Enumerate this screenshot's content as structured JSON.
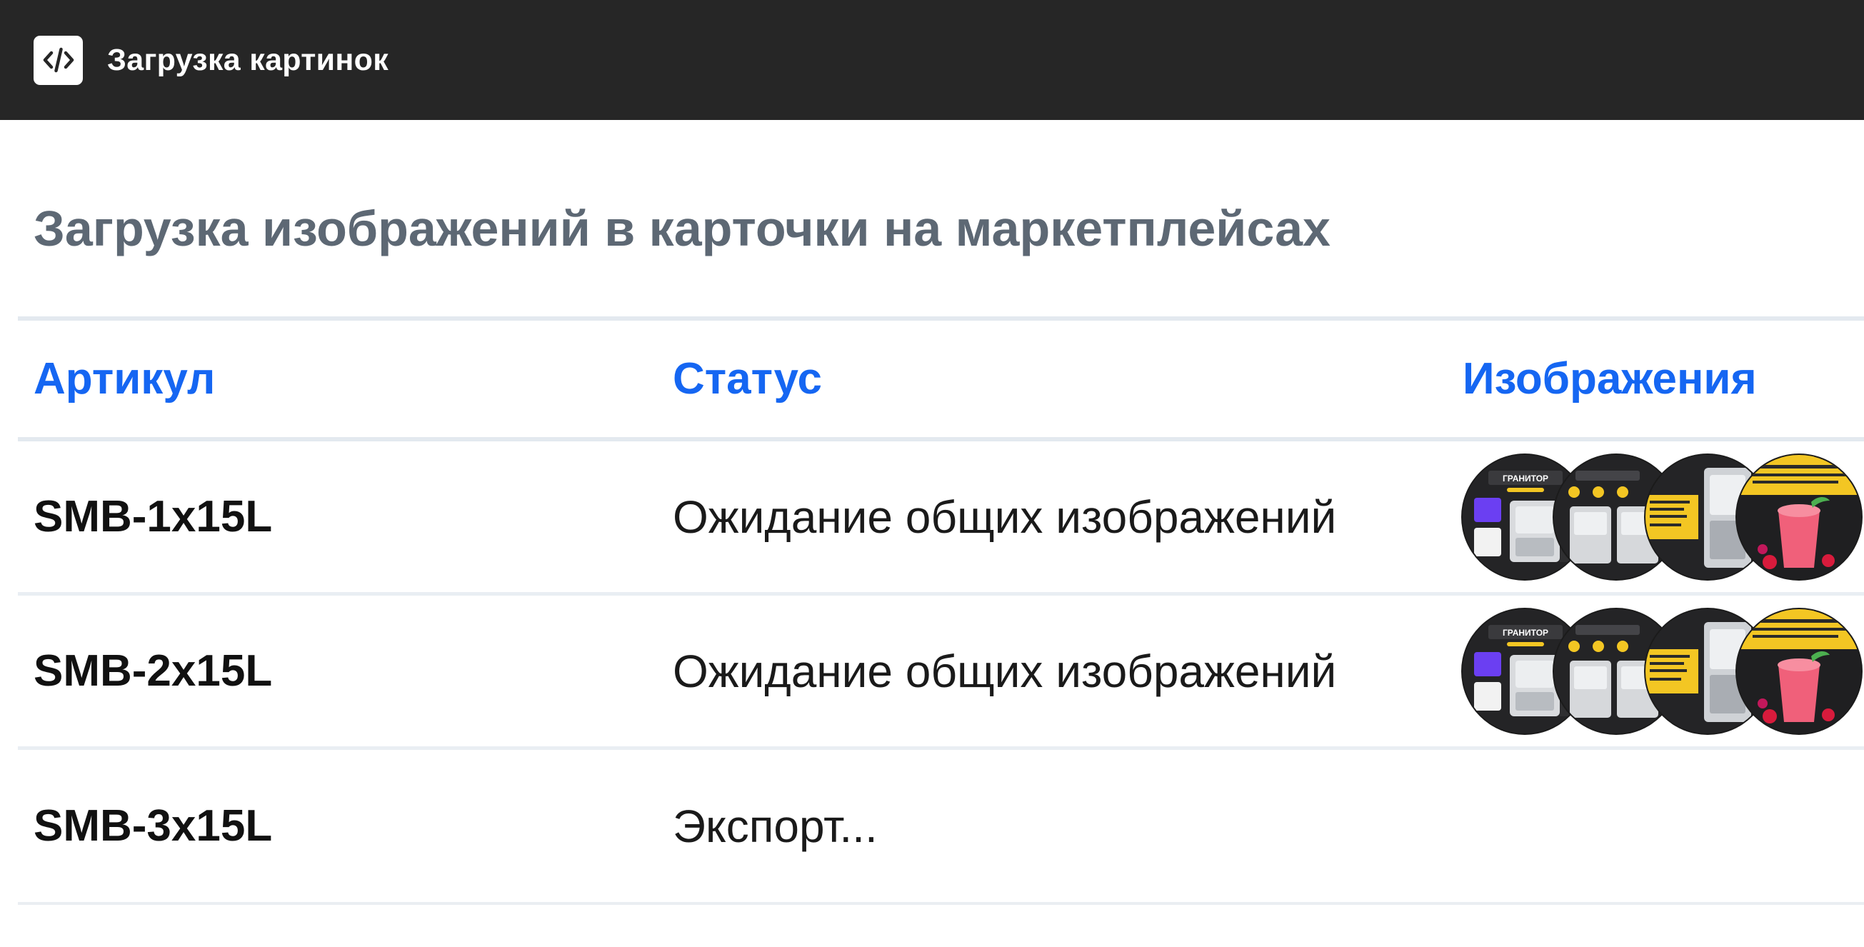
{
  "app": {
    "title": "Загрузка картинок",
    "icon": "code-icon"
  },
  "page": {
    "title": "Загрузка изображений в карточки на маркетплейсах"
  },
  "table": {
    "columns": [
      "Артикул",
      "Статус",
      "Изображения"
    ],
    "rows": [
      {
        "sku": "SMB-1x15L",
        "status": "Ожидание общих изображений",
        "images": [
          "product-card-image-1",
          "product-card-image-2",
          "product-card-image-3",
          "product-card-image-4"
        ]
      },
      {
        "sku": "SMB-2x15L",
        "status": "Ожидание общих изображений",
        "images": [
          "product-card-image-1",
          "product-card-image-2",
          "product-card-image-3",
          "product-card-image-4"
        ]
      },
      {
        "sku": "SMB-3x15L",
        "status": "Экспорт...",
        "images": []
      }
    ]
  },
  "thumbnail_text": {
    "banner": "ГРАНИТОР"
  },
  "colors": {
    "topbar": "#262626",
    "header_text": "#1566f2",
    "title_text": "#5d6874",
    "thumb_dark": "#242426",
    "thumb_yellow": "#f3c623",
    "thumb_purple": "#6b3ff2",
    "smoothie_pink": "#f0607a"
  }
}
